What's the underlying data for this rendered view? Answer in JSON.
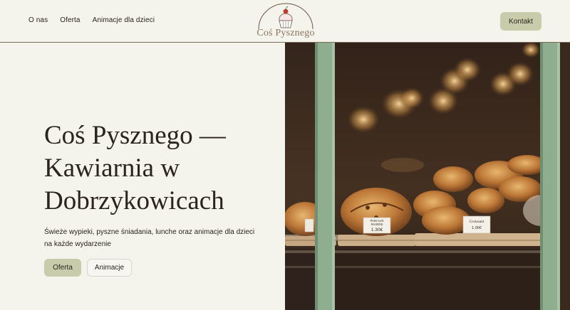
{
  "nav": {
    "items": [
      "O nas",
      "Oferta",
      "Animacje dla dzieci"
    ]
  },
  "logo": {
    "text": "Coś Pysznego"
  },
  "header": {
    "contact_label": "Kontakt"
  },
  "hero": {
    "title_line1": "Coś Pysznego —",
    "title_line2": "Kawiarnia w",
    "title_line3": "Dobrzykowicach",
    "subtitle_line1": "Świeże wypieki, pyszne śniadania, lunche oraz animacje dla dzieci",
    "subtitle_line2": "na każde wydarzenie",
    "primary_button": "Oferta",
    "secondary_button": "Animacje"
  },
  "photo": {
    "sign_left_line1": "PAIN AUX",
    "sign_left_line2": "RAISINS",
    "sign_left_price": "1.30€",
    "sign_right_line1": "Croissant",
    "sign_right_price": "1.00€"
  },
  "colors": {
    "background": "#f4f3ec",
    "accent_button": "#c8ccab",
    "window_frame": "#8fae8f",
    "text": "#2b241d"
  }
}
